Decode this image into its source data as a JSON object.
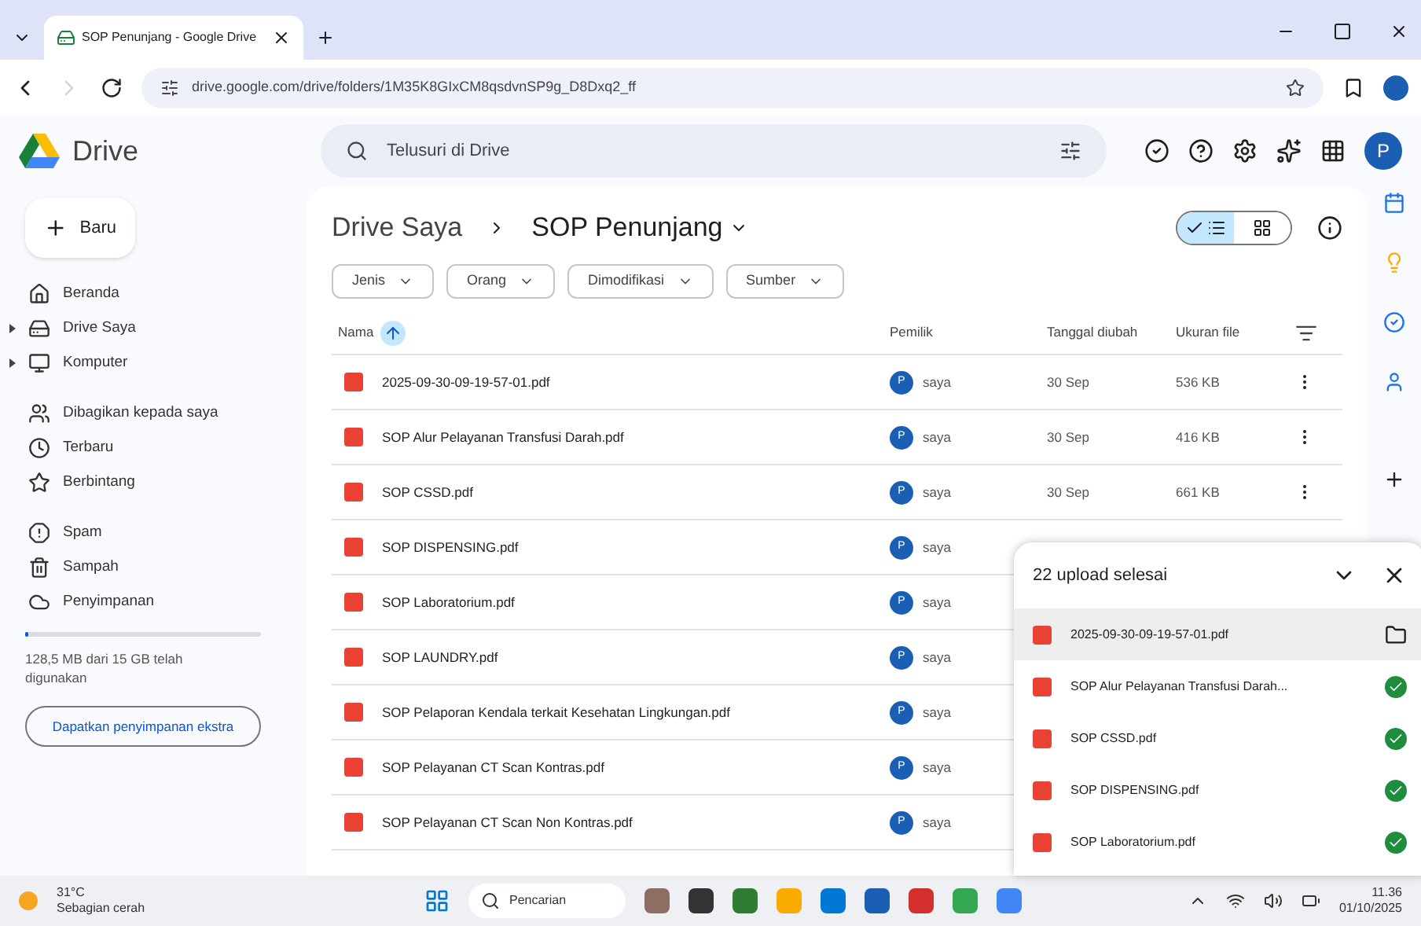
{
  "browser": {
    "tab_title": "SOP Penunjang - Google Drive",
    "url": "drive.google.com/drive/folders/1M35K8GIxCM8qsdvnSP9g_D8Dxq2_ff"
  },
  "header": {
    "app_name": "Drive",
    "search_placeholder": "Telusuri di Drive",
    "avatar": "P"
  },
  "sidebar": {
    "new_button": "Baru",
    "sections": [
      {
        "items": [
          {
            "label": "Beranda",
            "expandable": false
          },
          {
            "label": "Drive Saya",
            "expandable": true
          },
          {
            "label": "Komputer",
            "expandable": true
          }
        ]
      },
      {
        "items": [
          {
            "label": "Dibagikan kepada saya",
            "expandable": false
          },
          {
            "label": "Terbaru",
            "expandable": false
          },
          {
            "label": "Berbintang",
            "expandable": false
          }
        ]
      },
      {
        "items": [
          {
            "label": "Spam",
            "expandable": false
          },
          {
            "label": "Sampah",
            "expandable": false
          },
          {
            "label": "Penyimpanan",
            "expandable": false
          }
        ]
      }
    ],
    "storage": {
      "text": "128,5 MB dari 15 GB telah digunakan",
      "level": 0.01
    },
    "upgrade_button": "Dapatkan penyimpanan ekstra"
  },
  "breadcrumb": {
    "parent": "Drive Saya",
    "current": "SOP Penunjang"
  },
  "view_toggle": [
    {
      "kind": "list",
      "selected": true
    },
    {
      "kind": "grid",
      "selected": false
    }
  ],
  "filters": [
    "Jenis",
    "Orang",
    "Dimodifikasi",
    "Sumber"
  ],
  "table": {
    "columns": [
      "Nama",
      "Pemilik",
      "Tanggal diubah",
      "Ukuran file"
    ],
    "rows": [
      {
        "name": "2025-09-30-09-19-57-01.pdf",
        "avatar": "P",
        "owner": "saya",
        "modified": "30 Sep",
        "size": "536 KB"
      },
      {
        "name": "SOP Alur Pelayanan Transfusi Darah.pdf",
        "avatar": "P",
        "owner": "saya",
        "modified": "30 Sep",
        "size": "416 KB"
      },
      {
        "name": "SOP CSSD.pdf",
        "avatar": "P",
        "owner": "saya",
        "modified": "30 Sep",
        "size": "661 KB"
      },
      {
        "name": "SOP DISPENSING.pdf",
        "avatar": "P",
        "owner": "saya"
      },
      {
        "name": "SOP Laboratorium.pdf",
        "avatar": "P",
        "owner": "saya"
      },
      {
        "name": "SOP LAUNDRY.pdf",
        "avatar": "P",
        "owner": "saya"
      },
      {
        "name": "SOP Pelaporan Kendala terkait Kesehatan Lingkungan.pdf",
        "avatar": "P",
        "owner": "saya"
      },
      {
        "name": "SOP Pelayanan CT Scan Kontras.pdf",
        "avatar": "P",
        "owner": "saya"
      },
      {
        "name": "SOP Pelayanan CT Scan Non Kontras.pdf",
        "avatar": "P",
        "owner": "saya"
      }
    ]
  },
  "upload": {
    "title": "22 upload selesai",
    "items": [
      {
        "name": "2025-09-30-09-19-57-01.pdf",
        "selected": true
      },
      {
        "name": "SOP Alur Pelayanan Transfusi Darah...",
        "selected": false
      },
      {
        "name": "SOP CSSD.pdf",
        "selected": false
      },
      {
        "name": "SOP DISPENSING.pdf",
        "selected": false
      },
      {
        "name": "SOP Laboratorium.pdf",
        "selected": false
      }
    ]
  },
  "taskbar": {
    "weather_temp": "31°C",
    "weather_text": "Sebagian cerah",
    "search_placeholder": "Pencarian",
    "time": "11.36",
    "date": "01/10/2025"
  }
}
